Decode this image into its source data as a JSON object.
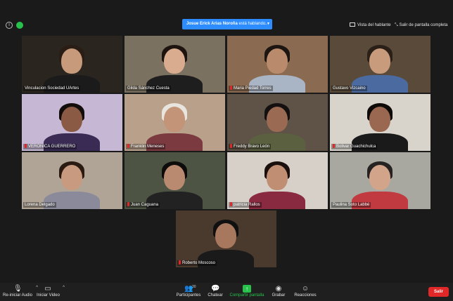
{
  "header": {
    "speaking_name": "Josue Erick Arias Noroña",
    "speaking_suffix": " está hablando...",
    "speaker_view_label": "Vista del hablante",
    "exit_fullscreen_label": "Salir de pantalla completa"
  },
  "participants": [
    {
      "name": "Vinculacion Sociedad UArtes",
      "muted": false,
      "bg": "#2b2520",
      "body": "#1b1b1b",
      "skin": "#c89a7c",
      "hair": "#2a1d15"
    },
    {
      "name": "Gilda Sánchez Cuesta",
      "muted": false,
      "bg": "#7b7160",
      "body": "#1e1e1e",
      "skin": "#d9ab8f",
      "hair": "#1d1410"
    },
    {
      "name": "Maria Piedad Torres",
      "muted": true,
      "bg": "#8a6a50",
      "body": "#a9b4c4",
      "skin": "#b98a6c",
      "hair": "#1c1511"
    },
    {
      "name": "Gustavo Vizcaino",
      "muted": false,
      "bg": "#5a4a3a",
      "body": "#4a6aa0",
      "skin": "#c99b7d",
      "hair": "#2b2018"
    },
    {
      "name": "VERONICA GUERRERO",
      "muted": true,
      "bg": "#c6b8d4",
      "body": "#3a2b55",
      "skin": "#8a5a44",
      "hair": "#120c0a"
    },
    {
      "name": "Franklin Meneses",
      "muted": true,
      "bg": "#b8a08a",
      "body": "#7a3a40",
      "skin": "#c49478",
      "hair": "#e8e4de"
    },
    {
      "name": "Freddy Bravo León",
      "muted": true,
      "bg": "#5e5346",
      "body": "#5a6040",
      "skin": "#9a6a52",
      "hair": "#141010"
    },
    {
      "name": "Bolivar Guachichulca",
      "muted": true,
      "bg": "#d8d4cc",
      "body": "#1a1a1a",
      "skin": "#9a6850",
      "hair": "#0e0a08"
    },
    {
      "name": "Lorena Delgado",
      "muted": false,
      "bg": "#b0a496",
      "body": "#8a8a9a",
      "skin": "#c89a80",
      "hair": "#2a1a12"
    },
    {
      "name": "Juan Caguana",
      "muted": true,
      "bg": "#4e5444",
      "body": "#222222",
      "skin": "#b98a70",
      "hair": "#0e0c0a"
    },
    {
      "name": "patricia Rallos",
      "muted": true,
      "bg": "#d6d0c8",
      "body": "#8a2a40",
      "skin": "#c08e72",
      "hair": "#1a0f0c"
    },
    {
      "name": "Paulina Soto Labbé",
      "muted": false,
      "bg": "#a8a8a0",
      "body": "#c03a40",
      "skin": "#d2a48a",
      "hair": "#262222"
    },
    {
      "name": "Roberto Moscoso",
      "muted": true,
      "bg": "#4a3a2e",
      "body": "#1a1a1a",
      "skin": "#a8785e",
      "hair": "#101010"
    }
  ],
  "toolbar": {
    "audio_label": "Re-iniciar Audio",
    "video_label": "Iniciar Video",
    "participants_label": "Participantes",
    "participants_count": "30",
    "chat_label": "Chatear",
    "share_label": "Compartir pantalla",
    "record_label": "Grabar",
    "reactions_label": "Reacciones",
    "end_label": "Salir"
  },
  "colors": {
    "accent": "#2d8cff",
    "share": "#27c24c",
    "end": "#e02828"
  }
}
